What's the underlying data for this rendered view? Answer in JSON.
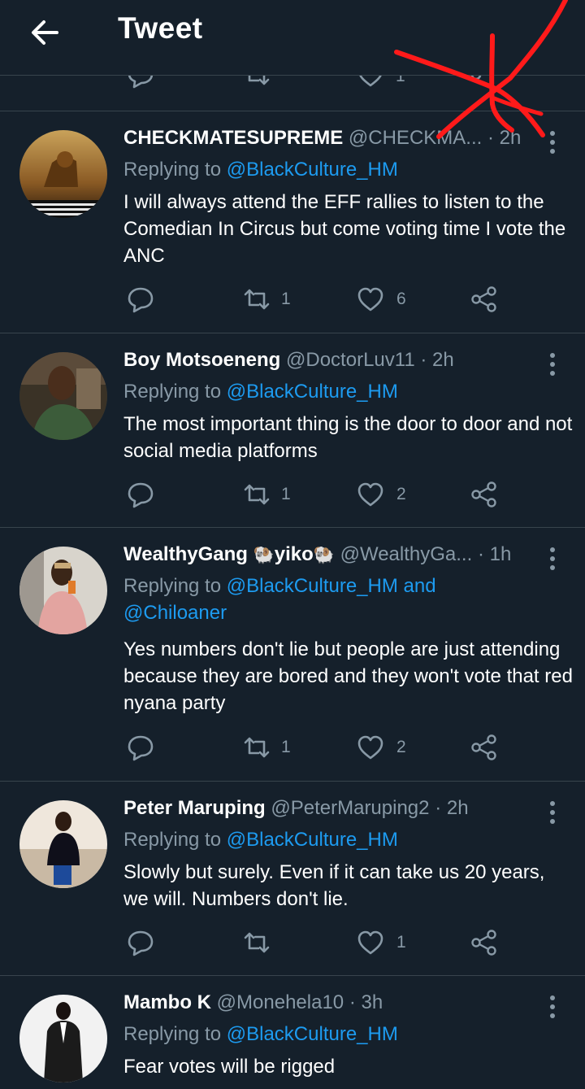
{
  "header": {
    "title": "Tweet"
  },
  "previous_tweet_actions": {
    "like_count": "1"
  },
  "tweets": [
    {
      "name": "CHECKMATESUPREME",
      "handle": "@CHECKMA...",
      "time": "· 2h",
      "replying_prefix": "Replying to ",
      "replying_to": "@BlackCulture_HM",
      "text": "I will always attend the EFF rallies to listen to the Comedian In Circus but come voting time I vote the ANC",
      "retweet_count": "1",
      "like_count": "6"
    },
    {
      "name": "Boy Motsoeneng",
      "handle": "@DoctorLuv11",
      "time": "· 2h",
      "replying_prefix": "Replying to ",
      "replying_to": "@BlackCulture_HM",
      "text": "The most important thing is the door to door and not social media platforms",
      "retweet_count": "1",
      "like_count": "2"
    },
    {
      "name": "WealthyGang",
      "name_emoji_1": "🐏",
      "name_part2": "yiko",
      "name_emoji_2": "🐏",
      "handle": "@WealthyGa...",
      "time": "· 1h",
      "replying_prefix": "Replying to ",
      "replying_to": "@BlackCulture_HM and @Chiloaner",
      "text": "Yes numbers don't lie but people are just attending because they are bored and they won't vote that red nyana party",
      "retweet_count": "1",
      "like_count": "2"
    },
    {
      "name": "Peter Maruping",
      "handle": "@PeterMaruping2",
      "time": "· 2h",
      "replying_prefix": "Replying to ",
      "replying_to": "@BlackCulture_HM",
      "text": "Slowly but surely. Even if it can take us 20 years, we will. Numbers don't lie.",
      "retweet_count": "",
      "like_count": "1"
    },
    {
      "name": "Mambo K",
      "handle": "@Monehela10",
      "time": "· 3h",
      "replying_prefix": "Replying to ",
      "replying_to": "@BlackCulture_HM",
      "text": "Fear votes will be rigged"
    }
  ],
  "colors": {
    "background": "#15202b",
    "divider": "#38444d",
    "secondary_text": "#8899a6",
    "link": "#1d9bf0",
    "annotation": "#ff1a1a"
  },
  "icons": [
    "back-arrow-icon",
    "reply-icon",
    "retweet-icon",
    "like-icon",
    "share-icon",
    "more-vertical-icon"
  ]
}
